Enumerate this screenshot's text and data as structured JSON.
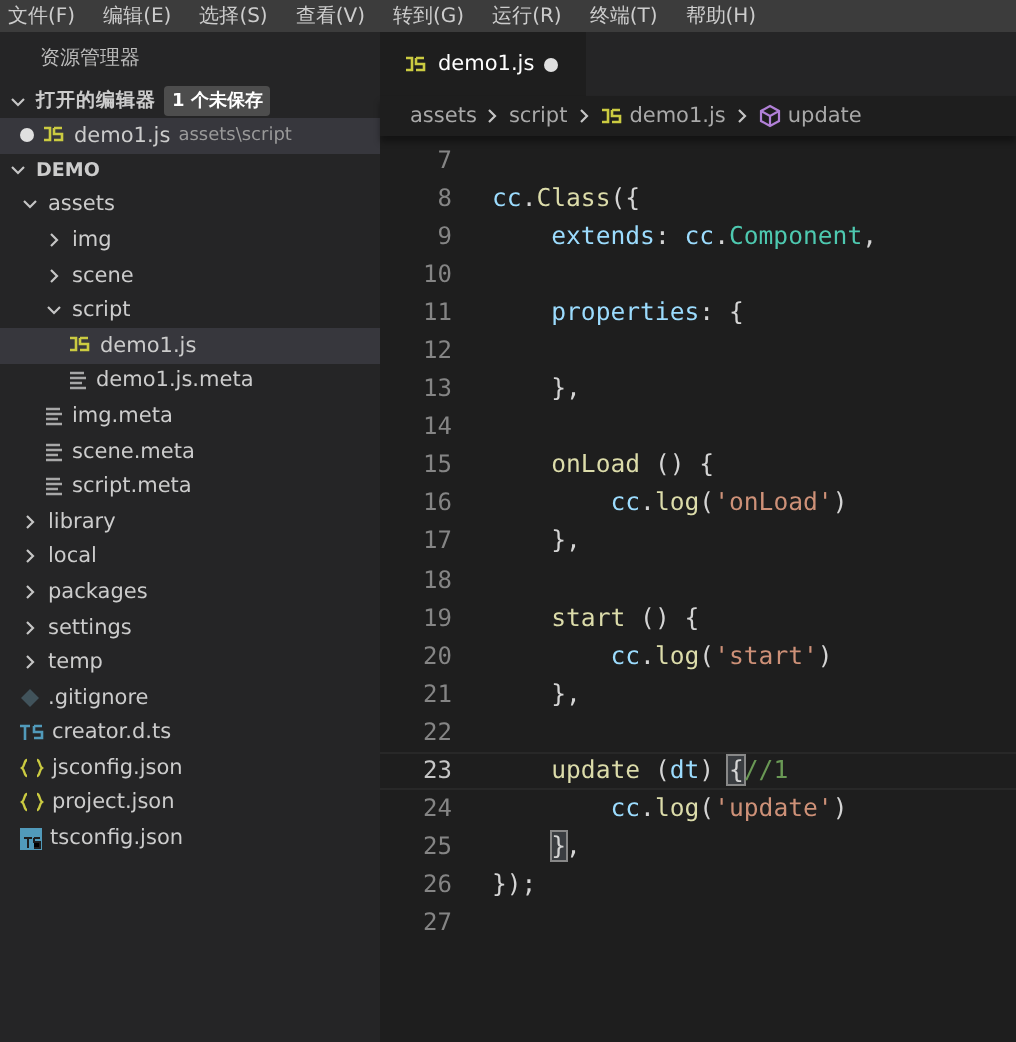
{
  "menu_bar": [
    "文件(F)",
    "编辑(E)",
    "选择(S)",
    "查看(V)",
    "转到(G)",
    "运行(R)",
    "终端(T)",
    "帮助(H)"
  ],
  "sidebar": {
    "title": "资源管理器",
    "open_editors": {
      "label": "打开的编辑器",
      "badge": "1 个未保存",
      "expanded": true,
      "items": [
        {
          "name": "demo1.js",
          "path": "assets\\script",
          "kind": "js",
          "dirty": true
        }
      ]
    },
    "project": {
      "label": "DEMO",
      "expanded": true,
      "tree": [
        {
          "name": "assets",
          "kind": "folder",
          "expanded": true,
          "selected": false,
          "children": [
            {
              "name": "img",
              "kind": "folder",
              "expanded": false,
              "selected": false
            },
            {
              "name": "scene",
              "kind": "folder",
              "expanded": false,
              "selected": false
            },
            {
              "name": "script",
              "kind": "folder",
              "expanded": true,
              "selected": false,
              "children": [
                {
                  "name": "demo1.js",
                  "kind": "js",
                  "selected": true
                },
                {
                  "name": "demo1.js.meta",
                  "kind": "meta",
                  "selected": false
                }
              ]
            },
            {
              "name": "img.meta",
              "kind": "meta",
              "selected": false
            },
            {
              "name": "scene.meta",
              "kind": "meta",
              "selected": false
            },
            {
              "name": "script.meta",
              "kind": "meta",
              "selected": false
            }
          ]
        },
        {
          "name": "library",
          "kind": "folder",
          "expanded": false,
          "selected": false
        },
        {
          "name": "local",
          "kind": "folder",
          "expanded": false,
          "selected": false
        },
        {
          "name": "packages",
          "kind": "folder",
          "expanded": false,
          "selected": false
        },
        {
          "name": "settings",
          "kind": "folder",
          "expanded": false,
          "selected": false
        },
        {
          "name": "temp",
          "kind": "folder",
          "expanded": false,
          "selected": false
        },
        {
          "name": ".gitignore",
          "kind": "git",
          "selected": false
        },
        {
          "name": "creator.d.ts",
          "kind": "ts",
          "selected": false
        },
        {
          "name": "jsconfig.json",
          "kind": "json",
          "selected": false
        },
        {
          "name": "project.json",
          "kind": "json",
          "selected": false
        },
        {
          "name": "tsconfig.json",
          "kind": "tsconfig",
          "selected": false
        }
      ]
    }
  },
  "tabs": [
    {
      "label": "demo1.js",
      "kind": "js",
      "selected": true,
      "dirty": true
    }
  ],
  "breadcrumb": [
    {
      "label": "assets",
      "kind": "folder"
    },
    {
      "label": "script",
      "kind": "folder"
    },
    {
      "label": "demo1.js",
      "kind": "js"
    },
    {
      "label": "update",
      "kind": "method"
    }
  ],
  "code": [
    {
      "number": "7",
      "current": false
    },
    {
      "number": "8",
      "current": false,
      "tokens": [
        {
          "text": "cc",
          "kind": "var"
        },
        {
          "text": ".",
          "kind": "plain"
        },
        {
          "text": "Class",
          "kind": "func"
        },
        {
          "text": "({",
          "kind": "plain"
        }
      ]
    },
    {
      "number": "9",
      "current": false,
      "tokens": [
        {
          "text": "    extends",
          "kind": "var"
        },
        {
          "text": ": ",
          "kind": "plain"
        },
        {
          "text": "cc",
          "kind": "var"
        },
        {
          "text": ".",
          "kind": "plain"
        },
        {
          "text": "Component",
          "kind": "type"
        },
        {
          "text": ",",
          "kind": "plain"
        }
      ]
    },
    {
      "number": "10",
      "current": false
    },
    {
      "number": "11",
      "current": false,
      "tokens": [
        {
          "text": "    properties",
          "kind": "var"
        },
        {
          "text": ": {",
          "kind": "plain"
        }
      ]
    },
    {
      "number": "12",
      "current": false
    },
    {
      "number": "13",
      "current": false,
      "tokens": [
        {
          "text": "    },",
          "kind": "plain"
        }
      ]
    },
    {
      "number": "14",
      "current": false
    },
    {
      "number": "15",
      "current": false,
      "tokens": [
        {
          "text": "    onLoad",
          "kind": "func"
        },
        {
          "text": " () {",
          "kind": "plain"
        }
      ]
    },
    {
      "number": "16",
      "current": false,
      "tokens": [
        {
          "text": "        cc",
          "kind": "var"
        },
        {
          "text": ".",
          "kind": "plain"
        },
        {
          "text": "log",
          "kind": "func"
        },
        {
          "text": "(",
          "kind": "plain"
        },
        {
          "text": "'onLoad'",
          "kind": "str"
        },
        {
          "text": ")",
          "kind": "plain"
        }
      ]
    },
    {
      "number": "17",
      "current": false,
      "tokens": [
        {
          "text": "    },",
          "kind": "plain"
        }
      ]
    },
    {
      "number": "18",
      "current": false
    },
    {
      "number": "19",
      "current": false,
      "tokens": [
        {
          "text": "    start",
          "kind": "func"
        },
        {
          "text": " () {",
          "kind": "plain"
        }
      ]
    },
    {
      "number": "20",
      "current": false,
      "tokens": [
        {
          "text": "        cc",
          "kind": "var"
        },
        {
          "text": ".",
          "kind": "plain"
        },
        {
          "text": "log",
          "kind": "func"
        },
        {
          "text": "(",
          "kind": "plain"
        },
        {
          "text": "'start'",
          "kind": "str"
        },
        {
          "text": ")",
          "kind": "plain"
        }
      ]
    },
    {
      "number": "21",
      "current": false,
      "tokens": [
        {
          "text": "    },",
          "kind": "plain"
        }
      ]
    },
    {
      "number": "22",
      "current": false
    },
    {
      "number": "23",
      "current": true,
      "tokens": [
        {
          "text": "    update",
          "kind": "func"
        },
        {
          "text": " (",
          "kind": "plain"
        },
        {
          "text": "dt",
          "kind": "param"
        },
        {
          "text": ") ",
          "kind": "plain"
        },
        {
          "text": "{",
          "kind": "bracket"
        },
        {
          "text": "//1",
          "kind": "comment"
        }
      ]
    },
    {
      "number": "24",
      "current": false,
      "tokens": [
        {
          "text": "        cc",
          "kind": "var"
        },
        {
          "text": ".",
          "kind": "plain"
        },
        {
          "text": "log",
          "kind": "func"
        },
        {
          "text": "(",
          "kind": "plain"
        },
        {
          "text": "'update'",
          "kind": "str"
        },
        {
          "text": ")",
          "kind": "plain"
        }
      ]
    },
    {
      "number": "25",
      "current": false,
      "tokens": [
        {
          "text": "    }",
          "kind": "bracket"
        },
        {
          "text": ",",
          "kind": "plain"
        }
      ]
    },
    {
      "number": "26",
      "current": false,
      "tokens": [
        {
          "text": "});",
          "kind": "plain"
        }
      ]
    },
    {
      "number": "27",
      "current": false
    }
  ]
}
